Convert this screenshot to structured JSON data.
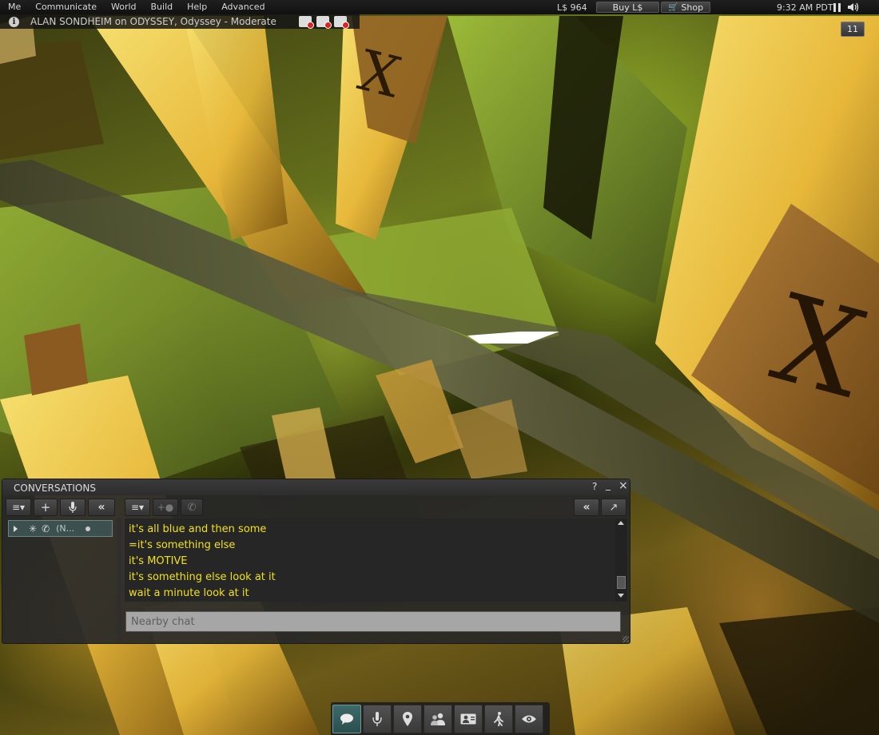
{
  "menu": {
    "items": [
      "Me",
      "Communicate",
      "World",
      "Build",
      "Help",
      "Advanced"
    ],
    "balance": "L$ 964",
    "buy_label": "Buy L$",
    "shop_label": "Shop",
    "time": "9:32 AM PDT"
  },
  "location": {
    "text": "ALAN SONDHEIM on ODYSSEY, Odyssey - Moderate"
  },
  "notifications": {
    "count": "11"
  },
  "conversations": {
    "title": "CONVERSATIONS",
    "help": "?",
    "minimize": "_",
    "close": "×",
    "tab_label": "(N...",
    "messages": [
      "it's all blue and then some",
      "=it's something else",
      "it's MOTIVE",
      "it's something else look at it",
      "wait a minute look at it"
    ],
    "input_placeholder": "Nearby chat"
  },
  "toolbar": {
    "buttons": [
      "chat",
      "speak",
      "places",
      "people",
      "profile",
      "walk",
      "view"
    ]
  },
  "colors": {
    "chat_text": "#f0e11c",
    "accent": "#3c5050"
  }
}
